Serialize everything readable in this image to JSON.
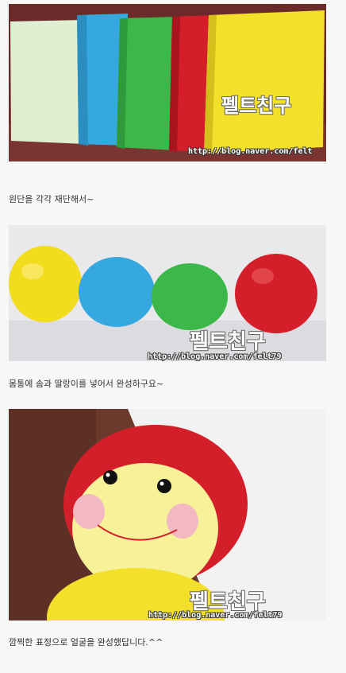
{
  "post": {
    "photos": [
      {
        "subject": "fabric-swatches",
        "watermark": "펠트친구",
        "url": "http://blog.naver.com/felt"
      },
      {
        "subject": "caterpillar-body",
        "watermark": "펠트친구",
        "url": "http://blog.naver.com/felt79"
      },
      {
        "subject": "caterpillar-face",
        "watermark": "펠트친구",
        "url": "http://blog.naver.com/felt79"
      }
    ],
    "captions": [
      "원단을 각각 재단해서~",
      "몸통에 솜과 딸랑이를 넣어서 완성하구요~",
      "깜찍한 표정으로 얼굴을 완성했답니다.^^"
    ]
  },
  "colors": {
    "background": "#f7f7f7",
    "caption_text": "#333333",
    "yellow": "#f2e02a",
    "blue": "#36a8e0",
    "green": "#3cb84a",
    "red": "#d41f2a",
    "mint": "#dff0d2"
  }
}
